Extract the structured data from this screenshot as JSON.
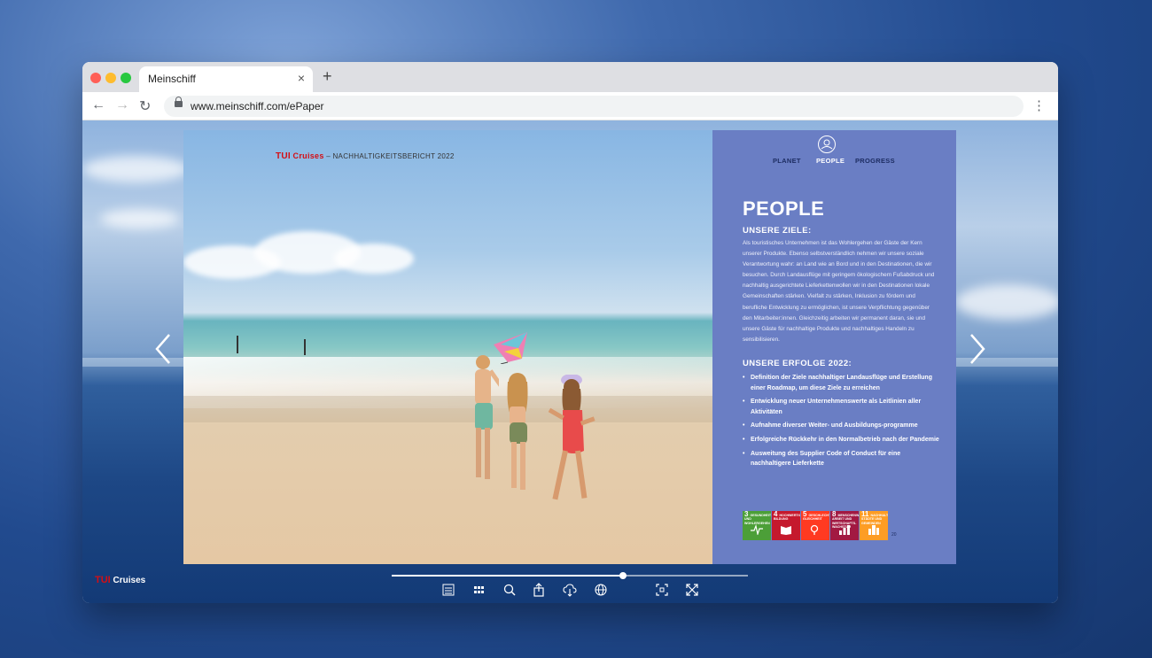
{
  "browser": {
    "tab_title": "Meinschiff",
    "tab_close": "×",
    "new_tab": "+",
    "url": "www.meinschiff.com/ePaper",
    "back": "←",
    "forward": "→",
    "reload": "↻",
    "menu": "⋮"
  },
  "epaper": {
    "header": {
      "brand_tui": "TUI",
      "brand_cruises": "Cruises",
      "subtitle": " – NACHHALTIGKEITSBERICHT 2022"
    },
    "nav": [
      "PLANET",
      "PEOPLE",
      "PROGRESS"
    ],
    "title": "PEOPLE",
    "goals_heading": "UNSERE ZIELE:",
    "goals_text": "Als touristisches Unternehmen ist das Wohlergehen der Gäste der Kern unserer Produkte. Ebenso selbstverständlich nehmen wir unsere soziale Verantwortung wahr: an Land wie an Bord und in den Destinationen, die wir besuchen. Durch Landausflüge mit geringem ökologischem Fußabdruck und nachhaltig ausgerichtete Lieferkettenwollen wir in den Destinationen lokale Gemeinschaften stärken. Vielfalt zu stärken, Inklusion zu fördern und berufliche Entwicklung zu ermöglichen, ist unsere Verpflichtung gegenüber den Mitarbeiter:innen. Gleichzeitig arbeiten wir permanent daran, sie und unsere Gäste für nachhaltige Produkte und nachhaltiges Handeln zu sensibilisieren.",
    "success_heading": "UNSERE ERFOLGE 2022:",
    "successes": [
      "Definition der Ziele nachhaltiger Landausflüge und Erstellung einer Roadmap, um diese Ziele zu erreichen",
      "Entwicklung neuer Unternehmenswerte als Leitlinien aller Aktivitäten",
      "Aufnahme diverser Weiter- und Ausbildungs-programme",
      "Erfolgreiche Rückkehr in den Normalbetrieb nach der Pandemie",
      "Ausweitung des Supplier Code of Conduct für eine nachhaltigere Lieferkette"
    ],
    "sdgs": [
      {
        "num": "3",
        "label": "GESUNDHEIT UND WOHLERGEHEN",
        "color": "#4c9f38"
      },
      {
        "num": "4",
        "label": "HOCHWERTIGE BILDUNG",
        "color": "#c5192d"
      },
      {
        "num": "5",
        "label": "GESCHLECHTER-GLEICHHEIT",
        "color": "#ff3a21"
      },
      {
        "num": "8",
        "label": "MENSCHENWÜRDIGE ARBEIT UND WIRTSCHAFTS-WACHSTUM",
        "color": "#a21942"
      },
      {
        "num": "11",
        "label": "NACHHALTIGE STÄDTE UND GEMEINDEN",
        "color": "#fd9d24"
      }
    ],
    "page_number": "20"
  },
  "viewer": {
    "brand_tui": "TUI",
    "brand_cruises": "Cruises",
    "progress": 0.65,
    "controls": [
      "table-of-contents-icon",
      "thumbnails-grid-icon",
      "search-icon",
      "share-icon",
      "download-icon",
      "language-globe-icon",
      "fit-page-icon",
      "fullscreen-icon"
    ]
  }
}
